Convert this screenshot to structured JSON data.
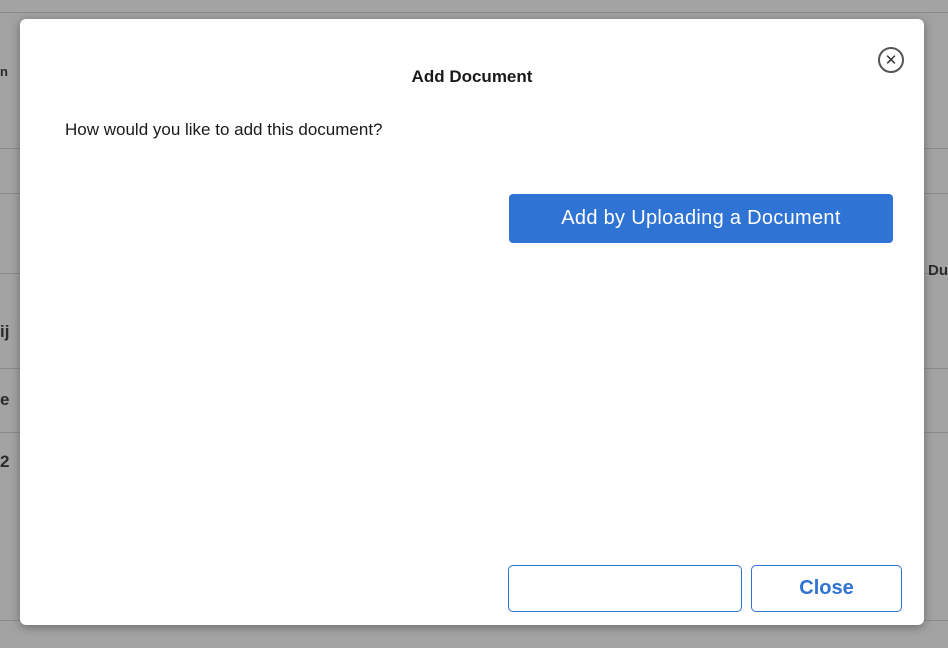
{
  "modal": {
    "title": "Add Document",
    "close_icon": "close-circle-icon",
    "close_glyph": "✕",
    "prompt": "How would you like to add this document?",
    "upload_button_label": "Add by Uploading a Document",
    "blank_button_label": "",
    "close_button_label": "Close"
  },
  "background": {
    "left_fragments": [
      "n",
      "ij",
      "e",
      "2"
    ],
    "right_fragments": [
      "Du"
    ]
  },
  "colors": {
    "accent": "#2f73d4",
    "overlay": "#a3a3a3"
  }
}
